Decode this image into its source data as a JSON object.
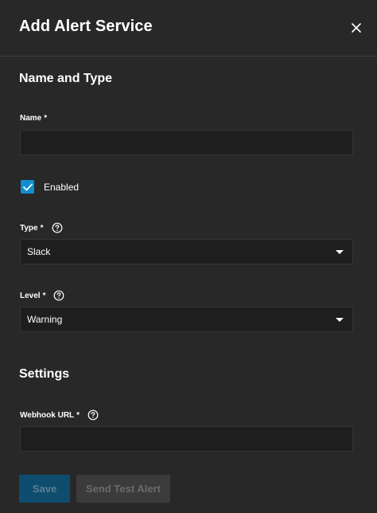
{
  "dialog": {
    "title": "Add Alert Service",
    "close_icon": "close-icon"
  },
  "sections": {
    "name_and_type": "Name and Type",
    "settings": "Settings"
  },
  "fields": {
    "name": {
      "label": "Name",
      "required_mark": "*",
      "value": "",
      "placeholder": ""
    },
    "enabled": {
      "label": "Enabled",
      "checked": true
    },
    "type": {
      "label": "Type",
      "required_mark": "*",
      "value": "Slack",
      "help_icon": "help-circle-icon"
    },
    "level": {
      "label": "Level",
      "required_mark": "*",
      "value": "Warning",
      "help_icon": "help-circle-icon"
    },
    "webhook_url": {
      "label": "Webhook URL",
      "required_mark": "*",
      "value": "",
      "placeholder": "",
      "help_icon": "help-circle-icon"
    }
  },
  "actions": {
    "save_label": "Save",
    "test_label": "Send Test Alert"
  },
  "colors": {
    "background": "#282828",
    "input_background": "#1e1e1e",
    "accent": "#0f8fd0",
    "save_disabled": "#0e4d6e",
    "test_disabled": "#3b3b3b"
  }
}
